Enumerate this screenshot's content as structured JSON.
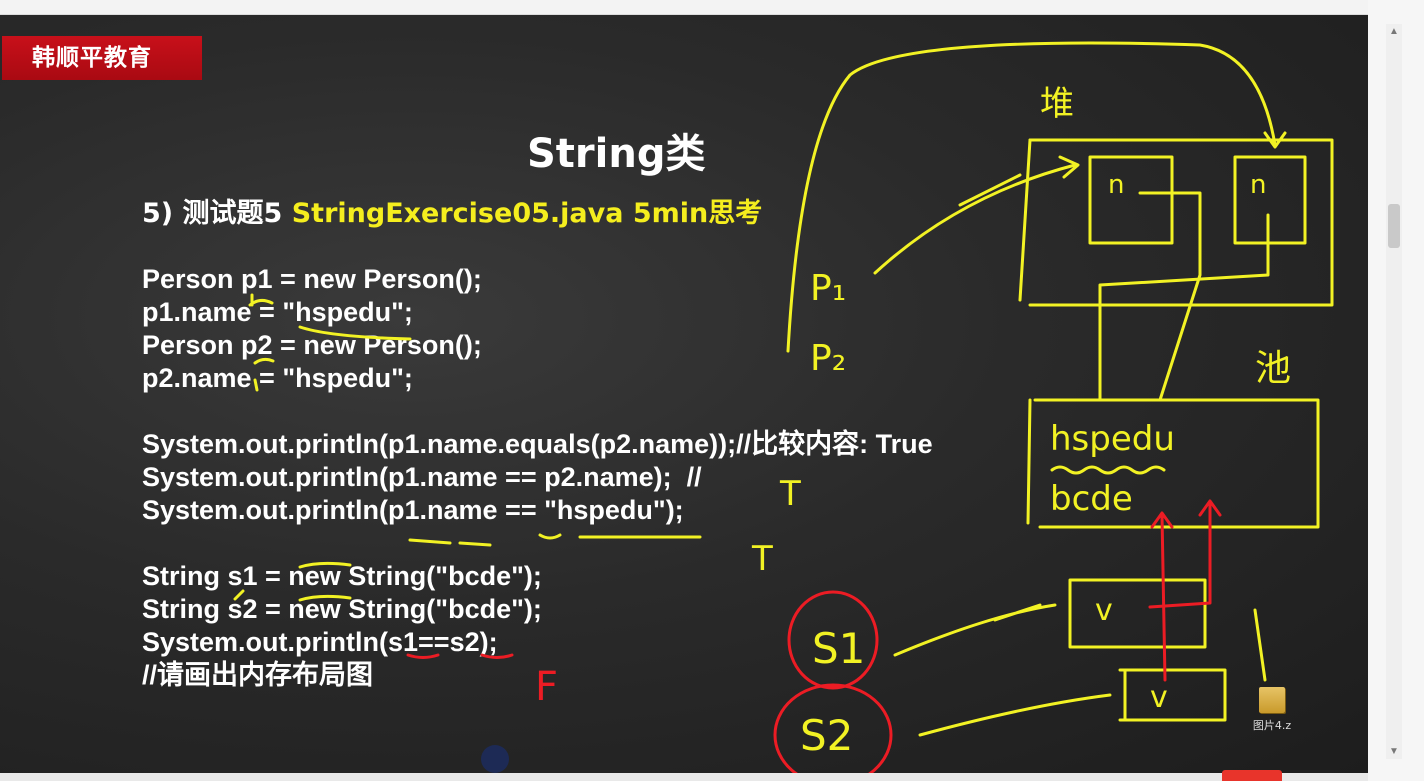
{
  "brand": "韩顺平教育",
  "title": "String类",
  "subtitle": {
    "prefix": "5) 测试题5 ",
    "file": "StringExercise05.java",
    "time": "5min思考"
  },
  "code_lines": [
    "Person p1 = new Person();",
    "p1.name = \"hspedu\";",
    "Person p2 = new Person();",
    "p2.name = \"hspedu\";",
    "",
    "System.out.println(p1.name.equals(p2.name));//比较内容: True",
    "System.out.println(p1.name == p2.name);  //",
    "System.out.println(p1.name == \"hspedu\");",
    "",
    "String s1 = new String(\"bcde\");",
    "String s2 = new String(\"bcde\");",
    "System.out.println(s1==s2);",
    "//请画出内存布局图"
  ],
  "annotations": {
    "heap_label": "堆",
    "pool_label": "池",
    "p1": "P₁",
    "p2": "P₂",
    "field_n": "n",
    "pool_values": [
      "hspedu",
      "bcde"
    ],
    "box_v": "v",
    "s1": "S1",
    "s2": "S2",
    "answer_t1": "T",
    "answer_t2": "T",
    "answer_f": "F"
  },
  "desktop_icon": {
    "name": "folder-icon",
    "label": "图片4.z"
  },
  "colors": {
    "brand_bg": "#c8101a",
    "highlight": "#f5ee1e",
    "chalk": "#ffffff",
    "marker_yellow": "#f2f224",
    "marker_red": "#ec1c24"
  }
}
